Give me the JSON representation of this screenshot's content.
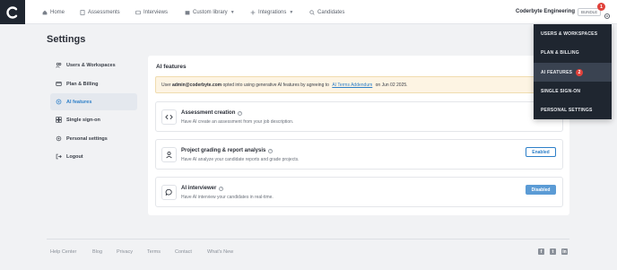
{
  "nav": {
    "items": [
      {
        "label": "Home",
        "icon": "home-icon"
      },
      {
        "label": "Assessments",
        "icon": "assessments-icon"
      },
      {
        "label": "Interviews",
        "icon": "interviews-icon"
      },
      {
        "label": "Custom library",
        "icon": "library-icon"
      },
      {
        "label": "Integrations",
        "icon": "integrations-icon"
      },
      {
        "label": "Candidates",
        "icon": "search-icon"
      }
    ],
    "org_name": "Coderbyte Engineering",
    "bundle_label": "BUNDLE",
    "notification_count": "1"
  },
  "dropdown": {
    "items": [
      {
        "label": "USERS & WORKSPACES"
      },
      {
        "label": "PLAN & BILLING"
      },
      {
        "label": "AI FEATURES",
        "badge": "2"
      },
      {
        "label": "SINGLE SIGN-ON"
      },
      {
        "label": "PERSONAL SETTINGS"
      }
    ]
  },
  "page": {
    "title": "Settings"
  },
  "sidebar": {
    "items": [
      {
        "label": "Users & Workspaces",
        "icon": "users-icon"
      },
      {
        "label": "Plan & Billing",
        "icon": "billing-icon"
      },
      {
        "label": "AI features",
        "icon": "ai-icon"
      },
      {
        "label": "Single sign-on",
        "icon": "sso-icon"
      },
      {
        "label": "Personal settings",
        "icon": "settings-icon"
      },
      {
        "label": "Logout",
        "icon": "logout-icon"
      }
    ]
  },
  "panel": {
    "title": "AI features",
    "notice": {
      "prefix": "User ",
      "email": "admin@coderbyte.com",
      "middle": " opted into using generative AI features by agreeing to ",
      "link": "AI Terms Addendum",
      "suffix": " on Jun 02 2025."
    },
    "features": [
      {
        "name": "Assessment creation",
        "desc": "Have AI create an assessment from your job description.",
        "status": "",
        "icon": "code-icon"
      },
      {
        "name": "Project grading & report analysis",
        "desc": "Have AI analyze your candidate reports and grade projects.",
        "status": "Enabled",
        "icon": "person-icon"
      },
      {
        "name": "AI interviewer",
        "desc": "Have AI interview your candidates in real-time.",
        "status": "Disabled",
        "icon": "chat-icon"
      }
    ]
  },
  "footer": {
    "links": [
      "Help Center",
      "Blog",
      "Privacy",
      "Terms",
      "Contact",
      "What's New"
    ],
    "social": [
      "facebook-icon",
      "twitter-icon",
      "linkedin-icon"
    ]
  },
  "colors": {
    "accent": "#2d7fc8",
    "dark": "#1f2630",
    "badge": "#e0413a",
    "notice_bg": "#fdf4e3"
  }
}
